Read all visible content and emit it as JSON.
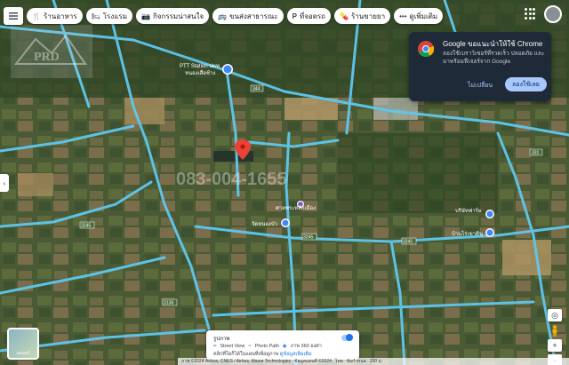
{
  "chips": [
    {
      "icon": "restaurant-icon",
      "glyph": "🍴",
      "label": "ร้านอาหาร"
    },
    {
      "icon": "hotel-icon",
      "glyph": "🛏",
      "label": "โรงแรม"
    },
    {
      "icon": "camera-icon",
      "glyph": "📷",
      "label": "กิจกรรมน่าสนใจ"
    },
    {
      "icon": "bus-icon",
      "glyph": "🚌",
      "label": "ขนส่งสาธารณะ"
    },
    {
      "icon": "parking-icon",
      "glyph": "P",
      "label": "ที่จอดรถ"
    },
    {
      "icon": "pharmacy-icon",
      "glyph": "💊",
      "label": "ร้านขายยา"
    },
    {
      "icon": "more-icon",
      "glyph": "•••",
      "label": "ดูเพิ่มเติม"
    }
  ],
  "watermark": "PRD",
  "phone_watermark": "083-004-1655",
  "map": {
    "places": [
      {
        "name": "PTT Station ปตท",
        "sub": "หนองเสือช้าง"
      },
      {
        "name": "ศาลพระหลักเมือง"
      },
      {
        "name": "วัดหนองบัว"
      },
      {
        "name": "บริษัทฟาร์ม"
      },
      {
        "name": "บ้านไร่เขาดิน"
      }
    ],
    "road_numbers": [
      "344",
      "331",
      "3245",
      "3245",
      "3138",
      "3245"
    ]
  },
  "chrome_promo": {
    "title": "Google ขอแนะนำให้ใช้ Chrome",
    "body": "ลองใช้เบราว์เซอร์ที่รวดเร็ว ปลอดภัย และมาพร้อมฟีเจอร์จาก Google",
    "no_label": "ไม่เปลี่ยน",
    "yes_label": "ลองใช้เลย",
    "accent": "#a8c7fa"
  },
  "layers_label": "เลเยอร์",
  "layer_panel": {
    "title": "รูปภาพ",
    "street_view": "Street View",
    "photo_path": "Photo Path",
    "photo_360": "ภาพ 360 องศา",
    "note": "คลิกที่ใดก็ได้ในแผนที่เพื่อดูภาพ",
    "link": "ดูข้อมูลเพิ่มเติม"
  },
  "footer": {
    "imagery": "ภาพ ©2024 Airbus, CNES / Airbus, Maxar Technologies",
    "map_data": "ข้อมูลแผนที่ ©2024",
    "country": "ไทย",
    "terms": "ข้อกำหนด",
    "scale": "200 ม."
  },
  "colors": {
    "road": "#5ec8f0",
    "pin": "#ea4335",
    "poi": "#4285f4"
  }
}
